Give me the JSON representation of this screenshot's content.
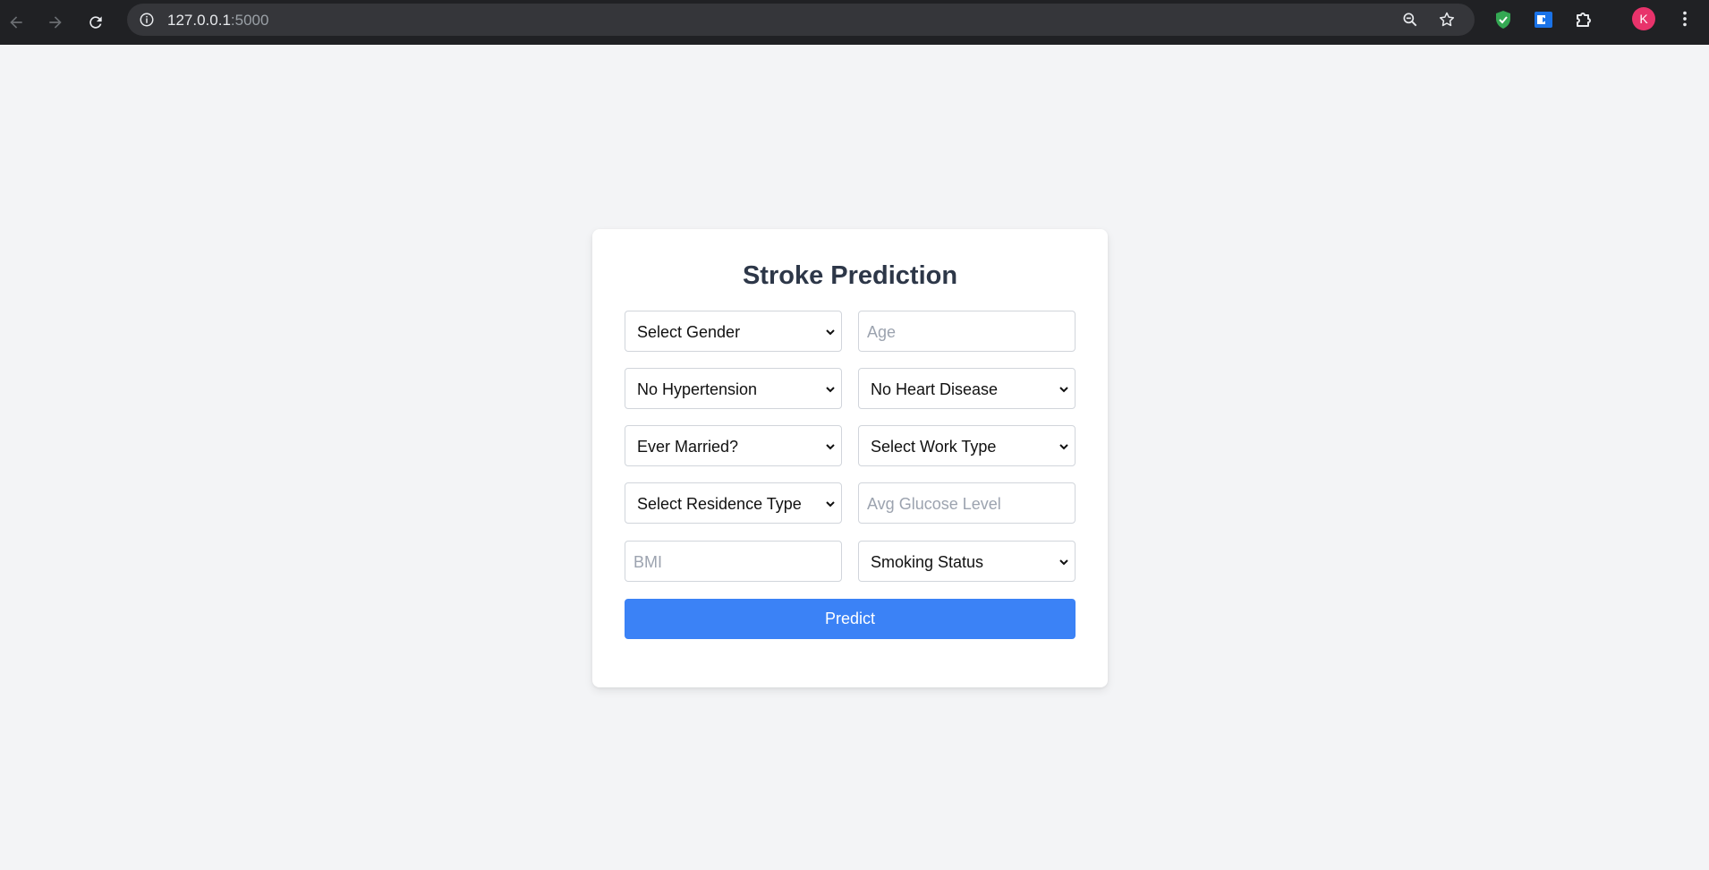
{
  "browser": {
    "url_host": "127.0.0.1",
    "url_port": ":5000",
    "avatar_letter": "K"
  },
  "form": {
    "title": "Stroke Prediction",
    "fields": [
      {
        "kind": "select",
        "value": "Select Gender"
      },
      {
        "kind": "input",
        "placeholder": "Age"
      },
      {
        "kind": "select",
        "value": "No Hypertension"
      },
      {
        "kind": "select",
        "value": "No Heart Disease"
      },
      {
        "kind": "select",
        "value": "Ever Married?"
      },
      {
        "kind": "select",
        "value": "Select Work Type"
      },
      {
        "kind": "select",
        "value": "Select Residence Type"
      },
      {
        "kind": "input",
        "placeholder": "Avg Glucose Level"
      },
      {
        "kind": "input",
        "placeholder": "BMI"
      },
      {
        "kind": "select",
        "value": "Smoking Status"
      }
    ],
    "submit_label": "Predict"
  },
  "colors": {
    "accent": "#3b82f6",
    "page_bg": "#f3f4f6",
    "title": "#2d3748",
    "avatar": "#e8336b"
  }
}
